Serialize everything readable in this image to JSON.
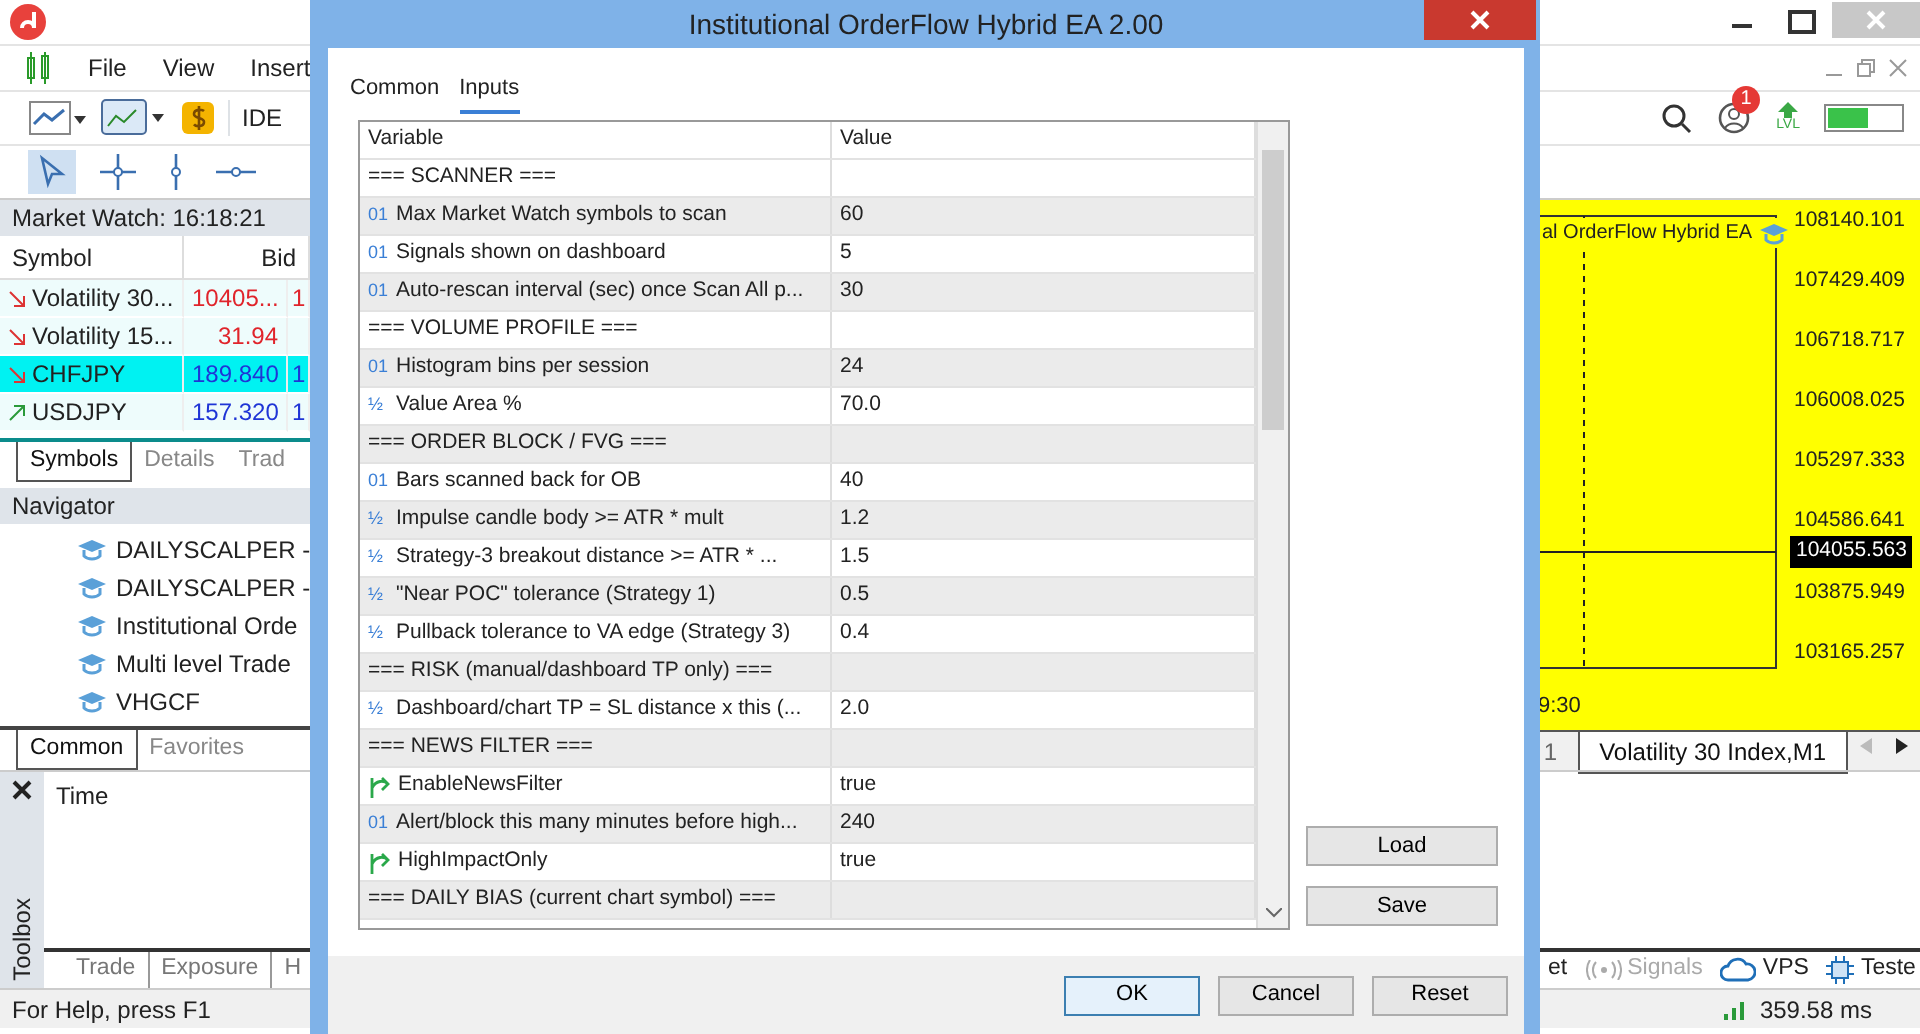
{
  "app": {
    "menu": [
      "File",
      "View",
      "Insert"
    ],
    "toolbar": {
      "ide_label": "IDE",
      "notification_count": "1",
      "lvl_label": "LVL"
    }
  },
  "market_watch": {
    "title": "Market Watch: 16:18:21",
    "columns": [
      "Symbol",
      "Bid"
    ],
    "rows": [
      {
        "symbol": "Volatility 30...",
        "kind": "down",
        "bid": "10405...",
        "column_3": "1",
        "color": "#e0242b",
        "selected": false
      },
      {
        "symbol": "Volatility 15...",
        "kind": "down",
        "bid": "31.94",
        "color": "#e0242b",
        "selected": false
      },
      {
        "symbol": "CHFJPY",
        "kind": "down",
        "bid": "189.840",
        "column_3": "1",
        "color": "#1f35d6",
        "selected": true
      },
      {
        "symbol": "USDJPY",
        "kind": "up",
        "bid": "157.320",
        "column_3": "1",
        "color": "#1f35d6",
        "selected": false
      }
    ],
    "tabs": [
      {
        "label": "Symbols",
        "selected": true
      },
      {
        "label": "Details",
        "selected": false
      },
      {
        "label": "Trad",
        "selected": false
      }
    ]
  },
  "navigator": {
    "title": "Navigator",
    "items": [
      "DAILYSCALPER -",
      "DAILYSCALPER -",
      "Institutional Orde",
      "Multi level Trade",
      "VHGCF"
    ],
    "tabs": [
      {
        "label": "Common",
        "selected": true
      },
      {
        "label": "Favorites",
        "selected": false
      }
    ]
  },
  "chart": {
    "ea_label": "al OrderFlow Hybrid EA",
    "price_labels": [
      "108140.101",
      "107429.409",
      "106718.717",
      "106008.025",
      "105297.333",
      "104586.641",
      "103875.949",
      "103165.257"
    ],
    "current_price": "104055.563",
    "time_label": "9:30",
    "tabs": [
      {
        "label": "1",
        "selected": false
      },
      {
        "label": "Volatility 30 Index,M1",
        "selected": true
      }
    ]
  },
  "toolbox": {
    "title": "Toolbox",
    "columns": [
      "Time"
    ],
    "tabs": [
      "Trade",
      "Exposure",
      "H"
    ],
    "right_tabs": [
      {
        "label": "et",
        "kind": "plain",
        "disabled": false
      },
      {
        "label": "Signals",
        "kind": "signals",
        "disabled": true
      },
      {
        "label": "VPS",
        "kind": "vps",
        "disabled": false
      },
      {
        "label": "Teste",
        "kind": "tester",
        "disabled": false
      }
    ]
  },
  "status_bar": {
    "help": "For Help, press F1",
    "ping": "359.58 ms"
  },
  "dialog": {
    "title": "Institutional OrderFlow Hybrid EA 2.00",
    "tabs": [
      {
        "label": "Common",
        "selected": false
      },
      {
        "label": "Inputs",
        "selected": true
      }
    ],
    "columns": [
      "Variable",
      "Value"
    ],
    "rows": [
      {
        "kind": "section",
        "variable": "=== SCANNER ==="
      },
      {
        "kind": "int",
        "type_label": "01",
        "variable": "Max Market Watch symbols to scan",
        "value": "60"
      },
      {
        "kind": "int",
        "type_label": "01",
        "variable": "Signals shown on dashboard",
        "value": "5"
      },
      {
        "kind": "int",
        "type_label": "01",
        "variable": "Auto-rescan interval (sec) once Scan All p...",
        "value": "30"
      },
      {
        "kind": "section",
        "variable": "=== VOLUME PROFILE ==="
      },
      {
        "kind": "int",
        "type_label": "01",
        "variable": "Histogram bins per session",
        "value": "24"
      },
      {
        "kind": "double",
        "type_label": "½",
        "variable": "Value Area %",
        "value": "70.0"
      },
      {
        "kind": "section",
        "variable": "=== ORDER BLOCK / FVG ==="
      },
      {
        "kind": "int",
        "type_label": "01",
        "variable": "Bars scanned back for OB",
        "value": "40"
      },
      {
        "kind": "double",
        "type_label": "½",
        "variable": "Impulse candle body >= ATR * mult",
        "value": "1.2"
      },
      {
        "kind": "double",
        "type_label": "½",
        "variable": "Strategy-3 breakout distance >= ATR * ...",
        "value": "1.5"
      },
      {
        "kind": "double",
        "type_label": "½",
        "variable": "\"Near POC\" tolerance (Strategy 1)",
        "value": "0.5"
      },
      {
        "kind": "double",
        "type_label": "½",
        "variable": "Pullback tolerance to VA edge (Strategy 3)",
        "value": "0.4"
      },
      {
        "kind": "section",
        "variable": "=== RISK (manual/dashboard TP only) ==="
      },
      {
        "kind": "double",
        "type_label": "½",
        "variable": "Dashboard/chart TP = SL distance x this (...",
        "value": "2.0"
      },
      {
        "kind": "section",
        "variable": "=== NEWS FILTER ==="
      },
      {
        "kind": "bool",
        "variable": "EnableNewsFilter",
        "value": "true"
      },
      {
        "kind": "int",
        "type_label": "01",
        "variable": "Alert/block this many minutes before high...",
        "value": "240"
      },
      {
        "kind": "bool",
        "variable": "HighImpactOnly",
        "value": "true"
      },
      {
        "kind": "section",
        "variable": "=== DAILY BIAS (current chart symbol) ==="
      }
    ],
    "side_buttons": [
      "Load",
      "Save"
    ],
    "buttons": [
      {
        "label": "OK",
        "default": true
      },
      {
        "label": "Cancel",
        "default": false
      },
      {
        "label": "Reset",
        "default": false
      }
    ]
  }
}
